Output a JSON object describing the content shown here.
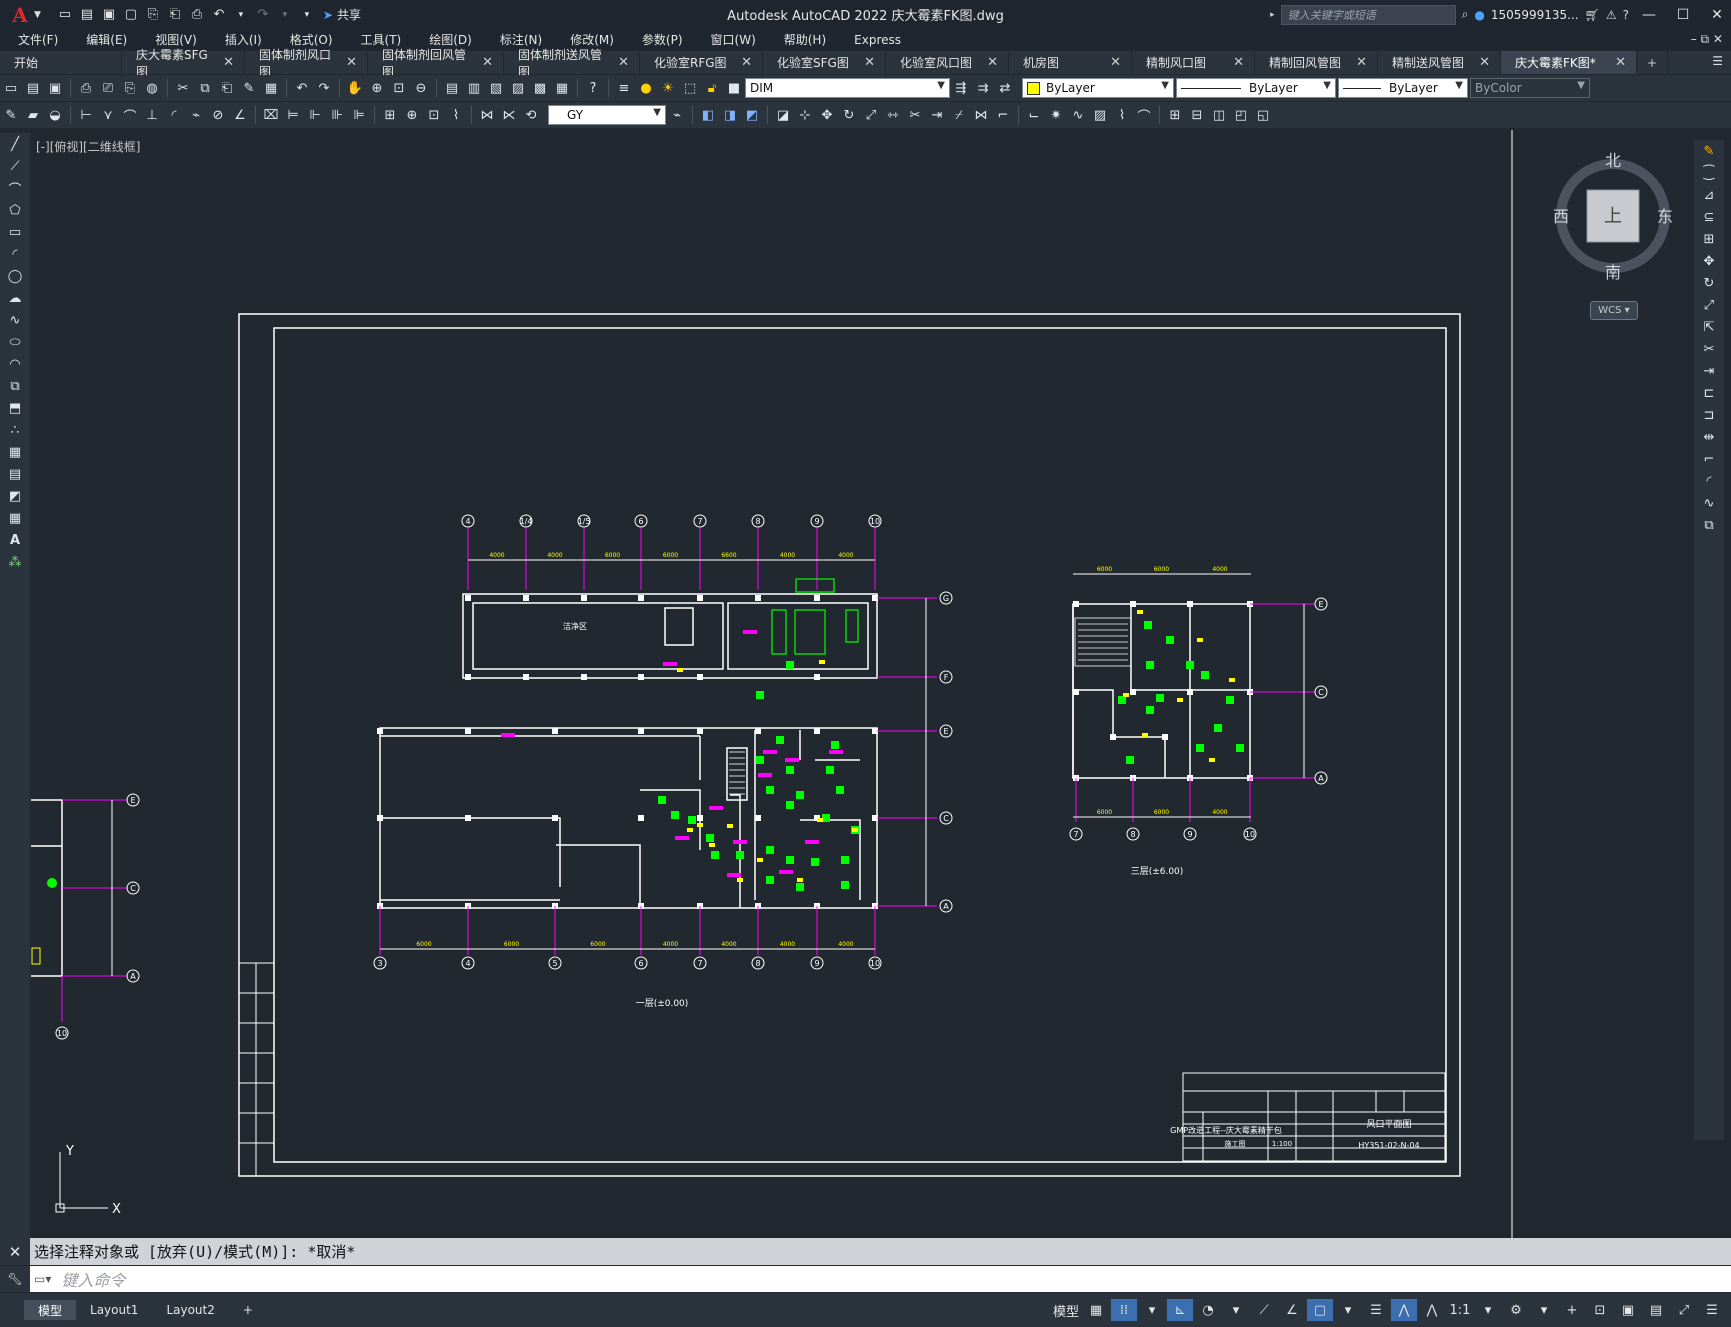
{
  "app": {
    "title": "Autodesk AutoCAD 2022    庆大霉素FK图.dwg",
    "logo": "A",
    "share_label": "共享",
    "search_placeholder": "键入关键字或短语",
    "user": "1505999135...",
    "colors": {
      "background": "#212830",
      "panel": "#2b333d",
      "magenta": "#ff00ff",
      "yellow": "#ffff00",
      "green": "#00ff00"
    }
  },
  "menu": [
    "文件(F)",
    "编辑(E)",
    "视图(V)",
    "插入(I)",
    "格式(O)",
    "工具(T)",
    "绘图(D)",
    "标注(N)",
    "修改(M)",
    "参数(P)",
    "窗口(W)",
    "帮助(H)",
    "Express"
  ],
  "tabs": [
    {
      "label": "开始",
      "closable": false
    },
    {
      "label": "庆大霉素SFG图",
      "closable": true
    },
    {
      "label": "固体制剂风口图",
      "closable": true
    },
    {
      "label": "固体制剂回风管图",
      "closable": true
    },
    {
      "label": "固体制剂送风管图",
      "closable": true
    },
    {
      "label": "化验室RFG图",
      "closable": true
    },
    {
      "label": "化验室SFG图",
      "closable": true
    },
    {
      "label": "化验室风口图",
      "closable": true
    },
    {
      "label": "机房图",
      "closable": true
    },
    {
      "label": "精制风口图",
      "closable": true
    },
    {
      "label": "精制回风管图",
      "closable": true
    },
    {
      "label": "精制送风管图",
      "closable": true
    },
    {
      "label": "庆大霉素FK图*",
      "closable": true,
      "active": true
    }
  ],
  "toolbar": {
    "layer": "DIM",
    "color": "ByLayer",
    "linetype": "ByLayer",
    "lineweight": "ByLayer",
    "plotstyle": "ByColor",
    "dimstyle": "GY"
  },
  "viewport": {
    "label": "[-][俯视][二维线框]",
    "compass": {
      "north": "北",
      "south": "南",
      "east": "东",
      "west": "西",
      "top": "上"
    },
    "wcs": "WCS",
    "ucs_y": "Y",
    "ucs_x": "X"
  },
  "drawing": {
    "grid_top": [
      "4",
      "1/4",
      "1/5",
      "6",
      "7",
      "8",
      "9",
      "10"
    ],
    "grid_bottom": [
      "3",
      "4",
      "5",
      "6",
      "7",
      "8",
      "9",
      "10"
    ],
    "grid_side": [
      "G",
      "F",
      "E",
      "C",
      "A"
    ],
    "dims_top": [
      "4000",
      "4000",
      "6000",
      "6000",
      "6600",
      "4000",
      "4000"
    ],
    "dims_bottom": [
      "6000",
      "6000",
      "6000",
      "4000",
      "4000",
      "4000",
      "4000"
    ],
    "plan1_title": "一层(±0.00)",
    "plan2_title": "三层(±6.00)",
    "plan2_grid_bottom": [
      "7",
      "8",
      "9",
      "10"
    ],
    "plan2_grid_side": [
      "E",
      "C",
      "A"
    ],
    "plan2_dims": [
      "6000",
      "6000",
      "4000"
    ],
    "left_grid_side": [
      "E",
      "C",
      "A"
    ],
    "left_grid_bottom": "10",
    "room_label": "洁净区",
    "titleblock": {
      "project": "GMP改造工程--庆大霉素精干包",
      "drawing_title": "风口平面图",
      "stage": "施工图",
      "scale": "1:100",
      "number": "HY351-02-N-04"
    }
  },
  "command": {
    "history": "选择注释对象或 [放弃(U)/模式(M)]: *取消*",
    "placeholder": "键入命令"
  },
  "layouts": [
    "模型",
    "Layout1",
    "Layout2"
  ],
  "status": {
    "model_label": "模型",
    "scale": "1:1"
  }
}
